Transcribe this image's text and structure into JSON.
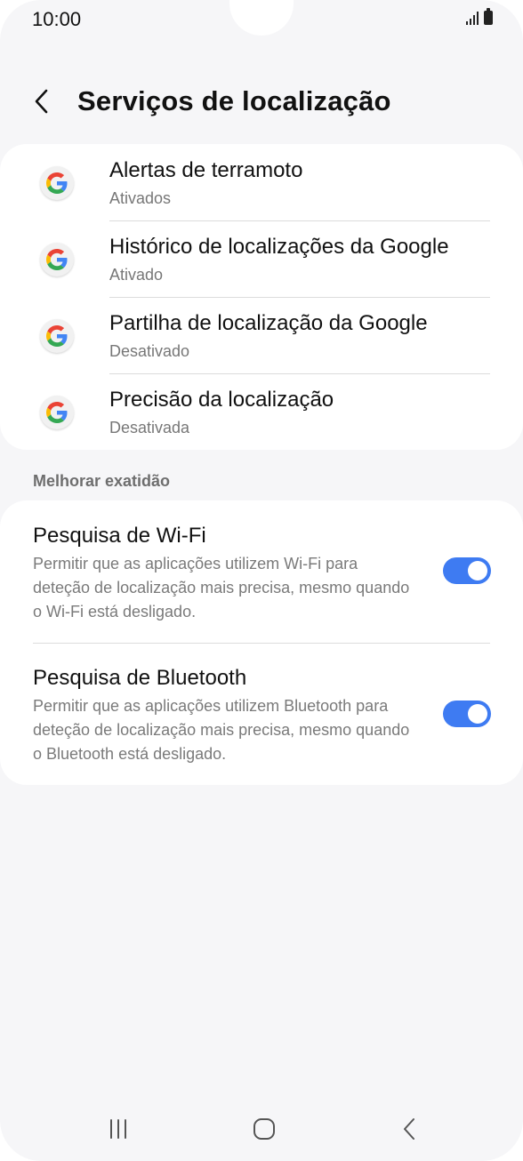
{
  "status_bar": {
    "time": "10:00"
  },
  "header": {
    "title": "Serviços de localização"
  },
  "services": [
    {
      "title": "Alertas de terramoto",
      "status": "Ativados"
    },
    {
      "title": "Histórico de localizações da Google",
      "status": "Ativado"
    },
    {
      "title": "Partilha de localização da Google",
      "status": "Desativado"
    },
    {
      "title": "Precisão da localização",
      "status": "Desativada"
    }
  ],
  "accuracy_section": {
    "label": "Melhorar exatidão",
    "items": [
      {
        "title": "Pesquisa de Wi-Fi",
        "description": "Permitir que as aplicações utilizem Wi-Fi para deteção de localização mais precisa, mesmo quando o Wi-Fi está desligado.",
        "enabled": true
      },
      {
        "title": "Pesquisa de Bluetooth",
        "description": "Permitir que as aplicações utilizem Bluetooth para deteção de localização mais precisa, mesmo quando o Bluetooth está desligado.",
        "enabled": true
      }
    ]
  },
  "colors": {
    "accent": "#3e7bf2",
    "background": "#f6f6f8",
    "card": "#ffffff",
    "secondary_text": "#777777"
  },
  "icons": {
    "back": "chevron-left-icon",
    "service": "google-icon",
    "nav_recents": "recents-icon",
    "nav_home": "home-icon",
    "nav_back": "back-icon"
  }
}
